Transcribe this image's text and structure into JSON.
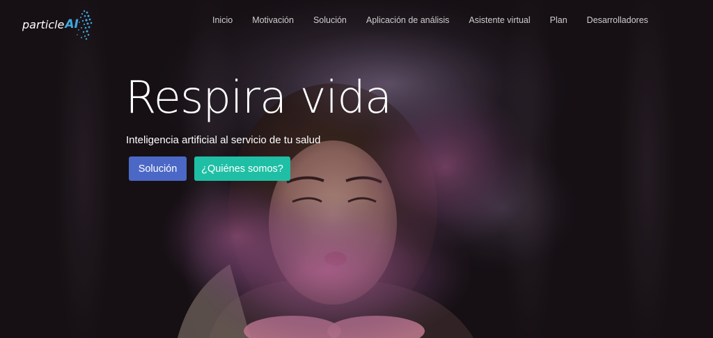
{
  "brand": {
    "text": "particle",
    "accent_text": "AI",
    "accent_color": "#3fa9e0",
    "icon": "particle-face-icon"
  },
  "nav": {
    "items": [
      {
        "label": "Inicio"
      },
      {
        "label": "Motivación"
      },
      {
        "label": "Solución"
      },
      {
        "label": "Aplicación de análisis"
      },
      {
        "label": "Asistente virtual"
      },
      {
        "label": "Plan"
      },
      {
        "label": "Desarrolladores"
      }
    ]
  },
  "hero": {
    "title": "Respira vida",
    "subtitle": "Inteligencia artificial al servicio de tu salud",
    "primary_button": "Solución",
    "secondary_button": "¿Quiénes somos?",
    "primary_color": "#4c68c6",
    "secondary_color": "#1fbfa5"
  }
}
